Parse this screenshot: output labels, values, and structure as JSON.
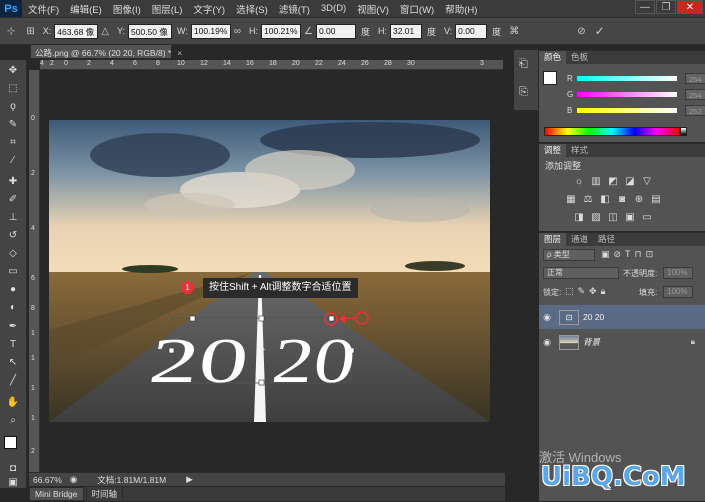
{
  "app": {
    "logo": "Ps"
  },
  "menu": [
    "文件(F)",
    "编辑(E)",
    "图像(I)",
    "图层(L)",
    "文字(Y)",
    "选择(S)",
    "滤镜(T)",
    "3D(D)",
    "视图(V)",
    "窗口(W)",
    "帮助(H)"
  ],
  "window_controls": {
    "minimize": "—",
    "restore": "❐",
    "close": "✕"
  },
  "options": {
    "x_label": "X:",
    "x_value": "463.68 像",
    "y_label": "Y:",
    "y_value": "500.50 像",
    "w_label": "W:",
    "w_value": "100.19%",
    "h_label": "H:",
    "h_value": "100.21%",
    "angle_value": "0.00",
    "angle_unit": "度",
    "hskew_label": "H:",
    "hskew_value": "32.01",
    "hskew_unit": "度",
    "vskew_label": "V:",
    "vskew_value": "0.00",
    "vskew_unit": "度"
  },
  "document": {
    "tab_title": "公路.png @ 66.7% (20 20, RGB/8) *",
    "tab_close": "×",
    "canvas_text_left": "20",
    "canvas_text_right": "20",
    "callout_number": "1",
    "callout_text": "按住Shift + Alt调整数字合适位置"
  },
  "ruler_h": [
    "4",
    "2",
    "0",
    "2",
    "4",
    "6",
    "8",
    "10",
    "12",
    "14",
    "16",
    "18",
    "20",
    "22",
    "24",
    "26",
    "28",
    "30",
    "3"
  ],
  "ruler_v": [
    "0",
    "2",
    "4",
    "6",
    "8",
    "1",
    "1",
    "1",
    "1",
    "2"
  ],
  "status": {
    "zoom": "66.67%",
    "doc": "文档:1.81M/1.81M"
  },
  "bottom_tabs": [
    "Mini Bridge",
    "时间轴"
  ],
  "color_panel": {
    "tabs": [
      "颜色",
      "色板"
    ],
    "channels": [
      {
        "label": "R",
        "value": "254"
      },
      {
        "label": "G",
        "value": "254"
      },
      {
        "label": "B",
        "value": "252"
      }
    ]
  },
  "adjust_panel": {
    "tabs": [
      "调整",
      "样式"
    ],
    "title": "添加调整"
  },
  "layers_panel": {
    "tabs": [
      "图层",
      "通道",
      "路径"
    ],
    "kind": "ρ 类型",
    "blend": "正常",
    "opacity_label": "不透明度:",
    "opacity": "100%",
    "lock_label": "锁定:",
    "fill_label": "填充:",
    "fill": "100%",
    "layers": [
      {
        "name": "20 20",
        "selected": true
      },
      {
        "name": "背景",
        "selected": false
      }
    ]
  },
  "watermark": {
    "activate": "激活 Windows",
    "site": "UiBQ.CoM"
  },
  "colors": {
    "accent_red": "#e8313a",
    "selected_layer": "#5b6a84"
  }
}
